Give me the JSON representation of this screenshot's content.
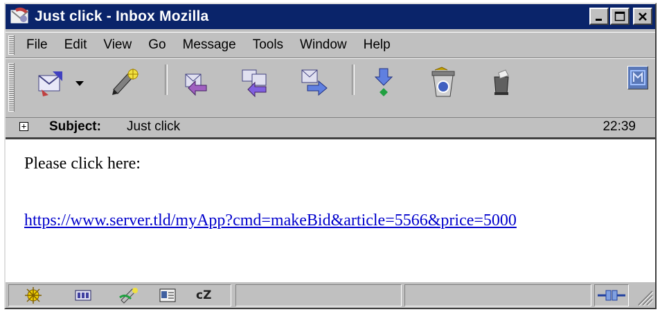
{
  "window": {
    "title": "Just click - Inbox Mozilla",
    "controls": [
      "minimize-icon",
      "maximize-icon",
      "close-icon"
    ]
  },
  "menu": {
    "items": [
      {
        "label": "File"
      },
      {
        "label": "Edit"
      },
      {
        "label": "View"
      },
      {
        "label": "Go"
      },
      {
        "label": "Message"
      },
      {
        "label": "Tools"
      },
      {
        "label": "Window"
      },
      {
        "label": "Help"
      }
    ]
  },
  "toolbar": {
    "buttons": [
      "get-msg-icon",
      "dropdown-arrow-icon",
      "compose-icon",
      "reply-icon",
      "reply-all-icon",
      "forward-icon",
      "next-icon",
      "delete-icon",
      "stop-icon",
      "mozilla-logo-icon"
    ]
  },
  "header": {
    "subject_label": "Subject:",
    "subject_value": "Just click",
    "time": "22:39",
    "expand_symbol": "+"
  },
  "message": {
    "line1": "Please click here:",
    "link": "https://www.server.tld/myApp?cmd=makeBid&article=5566&price=5000"
  },
  "statusbar": {
    "icons": [
      "navigator-icon",
      "mail-icon",
      "composer-icon",
      "address-book-icon",
      "chatzilla-icon"
    ],
    "chatzilla_text": "cZ"
  },
  "colors": {
    "titlebar": "#0a246a",
    "chrome": "#c0c0c0",
    "link": "#0000cc"
  }
}
